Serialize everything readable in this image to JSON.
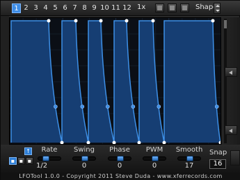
{
  "toolbar": {
    "tabs": [
      "1",
      "2",
      "3",
      "4",
      "5",
      "6",
      "7",
      "8",
      "9",
      "10",
      "11",
      "12"
    ],
    "active_tab": "1",
    "multiplier": "1x",
    "shape_label": "Shape"
  },
  "graph": {
    "line_color": "#3d8fe6",
    "fill_color": "#163e73",
    "node_color": "#ffffff",
    "mid_node_color": "#3d8fe6"
  },
  "controls": {
    "rate": {
      "label": "Rate",
      "value": "1/2",
      "level": 0.25
    },
    "swing": {
      "label": "Swing",
      "value": "0",
      "level": 0.5
    },
    "phase": {
      "label": "Phase",
      "value": "0",
      "level": 0.5
    },
    "pwm": {
      "label": "PWM",
      "value": "0",
      "level": 0.5
    },
    "smooth": {
      "label": "Smooth",
      "value": "17",
      "level": 0.5
    },
    "snap": {
      "label": "Snap",
      "value": "16"
    }
  },
  "footer": {
    "text": "LFOTool 1.0.0 - Copyright 2011 Steve Duda - www.xferrecords.com"
  }
}
